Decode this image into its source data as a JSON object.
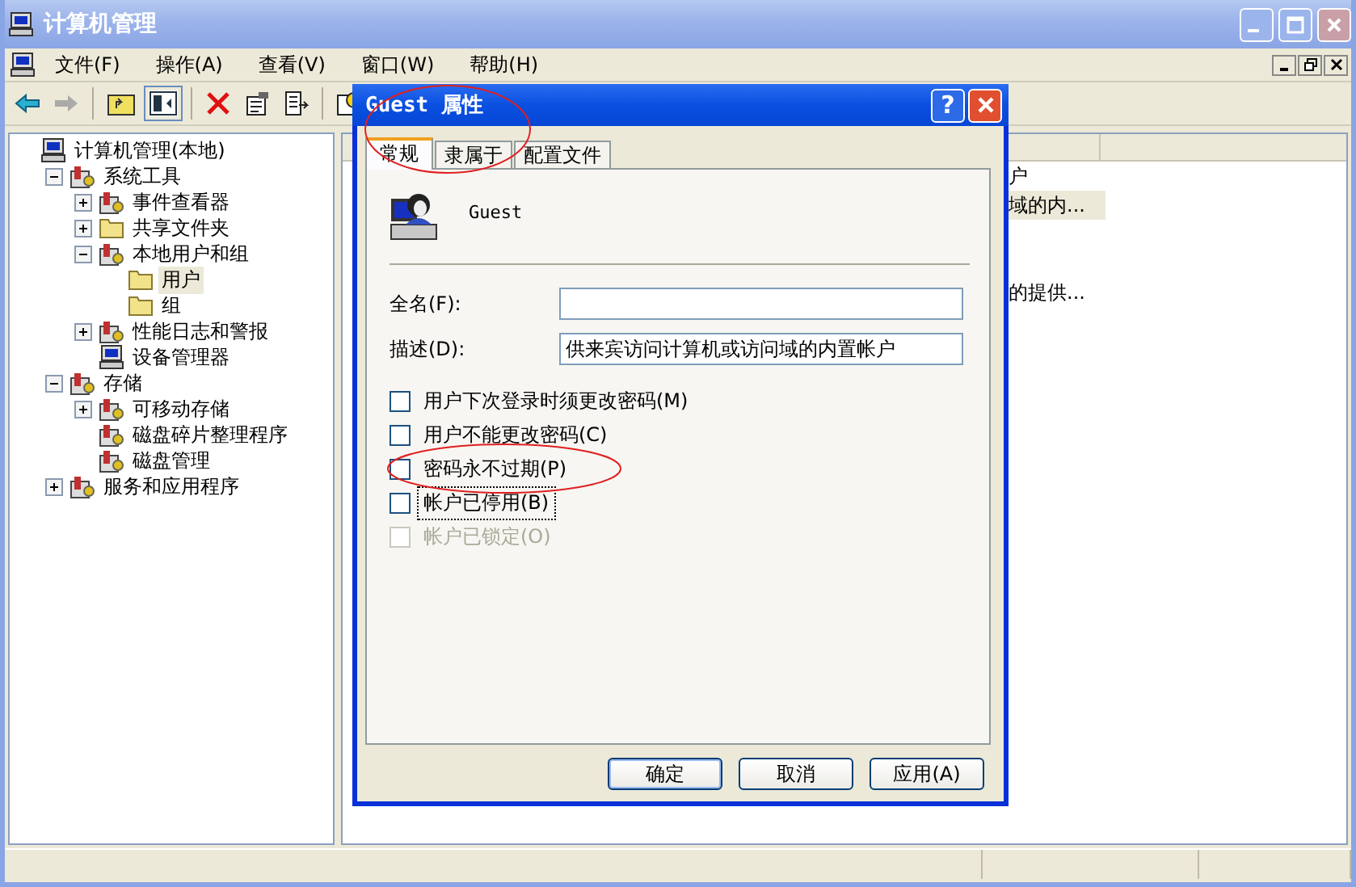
{
  "window": {
    "title": "计算机管理"
  },
  "menu": [
    {
      "label": "文件(F)"
    },
    {
      "label": "操作(A)"
    },
    {
      "label": "查看(V)"
    },
    {
      "label": "窗口(W)"
    },
    {
      "label": "帮助(H)"
    }
  ],
  "tree": [
    {
      "label": "计算机管理(本地)",
      "kind": "computer",
      "selected": false,
      "children": [
        {
          "label": "系统工具",
          "kind": "tool",
          "selected": false,
          "expanded": true,
          "children": [
            {
              "label": "事件查看器",
              "kind": "tool",
              "selected": false,
              "expanded": false
            },
            {
              "label": "共享文件夹",
              "kind": "folder",
              "selected": false,
              "expanded": false
            },
            {
              "label": "本地用户和组",
              "kind": "tool",
              "selected": false,
              "expanded": true,
              "children": [
                {
                  "label": "用户",
                  "kind": "folder",
                  "selected": true
                },
                {
                  "label": "组",
                  "kind": "folder",
                  "selected": false
                }
              ]
            },
            {
              "label": "性能日志和警报",
              "kind": "tool",
              "selected": false,
              "expanded": false
            },
            {
              "label": "设备管理器",
              "kind": "computer",
              "selected": false
            }
          ]
        },
        {
          "label": "存储",
          "kind": "tool",
          "selected": false,
          "expanded": true,
          "children": [
            {
              "label": "可移动存储",
              "kind": "tool",
              "selected": false,
              "expanded": false
            },
            {
              "label": "磁盘碎片整理程序",
              "kind": "tool",
              "selected": false
            },
            {
              "label": "磁盘管理",
              "kind": "tool",
              "selected": false
            }
          ]
        },
        {
          "label": "服务和应用程序",
          "kind": "tool",
          "selected": false,
          "expanded": false
        }
      ]
    }
  ],
  "list": {
    "rows": [
      {
        "selected": false,
        "description": "户"
      },
      {
        "selected": true,
        "description": "域的内..."
      },
      {
        "selected": false
      },
      {
        "selected": false
      },
      {
        "selected": false,
        "description": "的提供..."
      }
    ]
  },
  "dialog": {
    "title": "Guest 属性",
    "help_button": "?",
    "tabs": [
      {
        "label": "常规",
        "selected": true
      },
      {
        "label": "隶属于",
        "selected": false
      },
      {
        "label": "配置文件",
        "selected": false
      }
    ],
    "user_name": "Guest",
    "fields": [
      {
        "label": "全名(F):"
      },
      {
        "label": "描述(D):",
        "value": "供来宾访问计算机或访问域的内置帐户"
      }
    ],
    "checkboxes": [
      {
        "label": "用户下次登录时须更改密码(M)",
        "checked": false,
        "disabled": false,
        "focused": false
      },
      {
        "label": "用户不能更改密码(C)",
        "checked": false,
        "disabled": false,
        "focused": false
      },
      {
        "label": "密码永不过期(P)",
        "checked": false,
        "disabled": false,
        "focused": false
      },
      {
        "label": "帐户已停用(B)",
        "checked": false,
        "disabled": false,
        "focused": true
      },
      {
        "label": "帐户已锁定(O)",
        "checked": false,
        "disabled": true,
        "focused": false
      }
    ],
    "buttons": [
      {
        "label": "确定",
        "default": true
      },
      {
        "label": "取消",
        "default": false
      },
      {
        "label": "应用(A)",
        "default": false
      }
    ]
  }
}
